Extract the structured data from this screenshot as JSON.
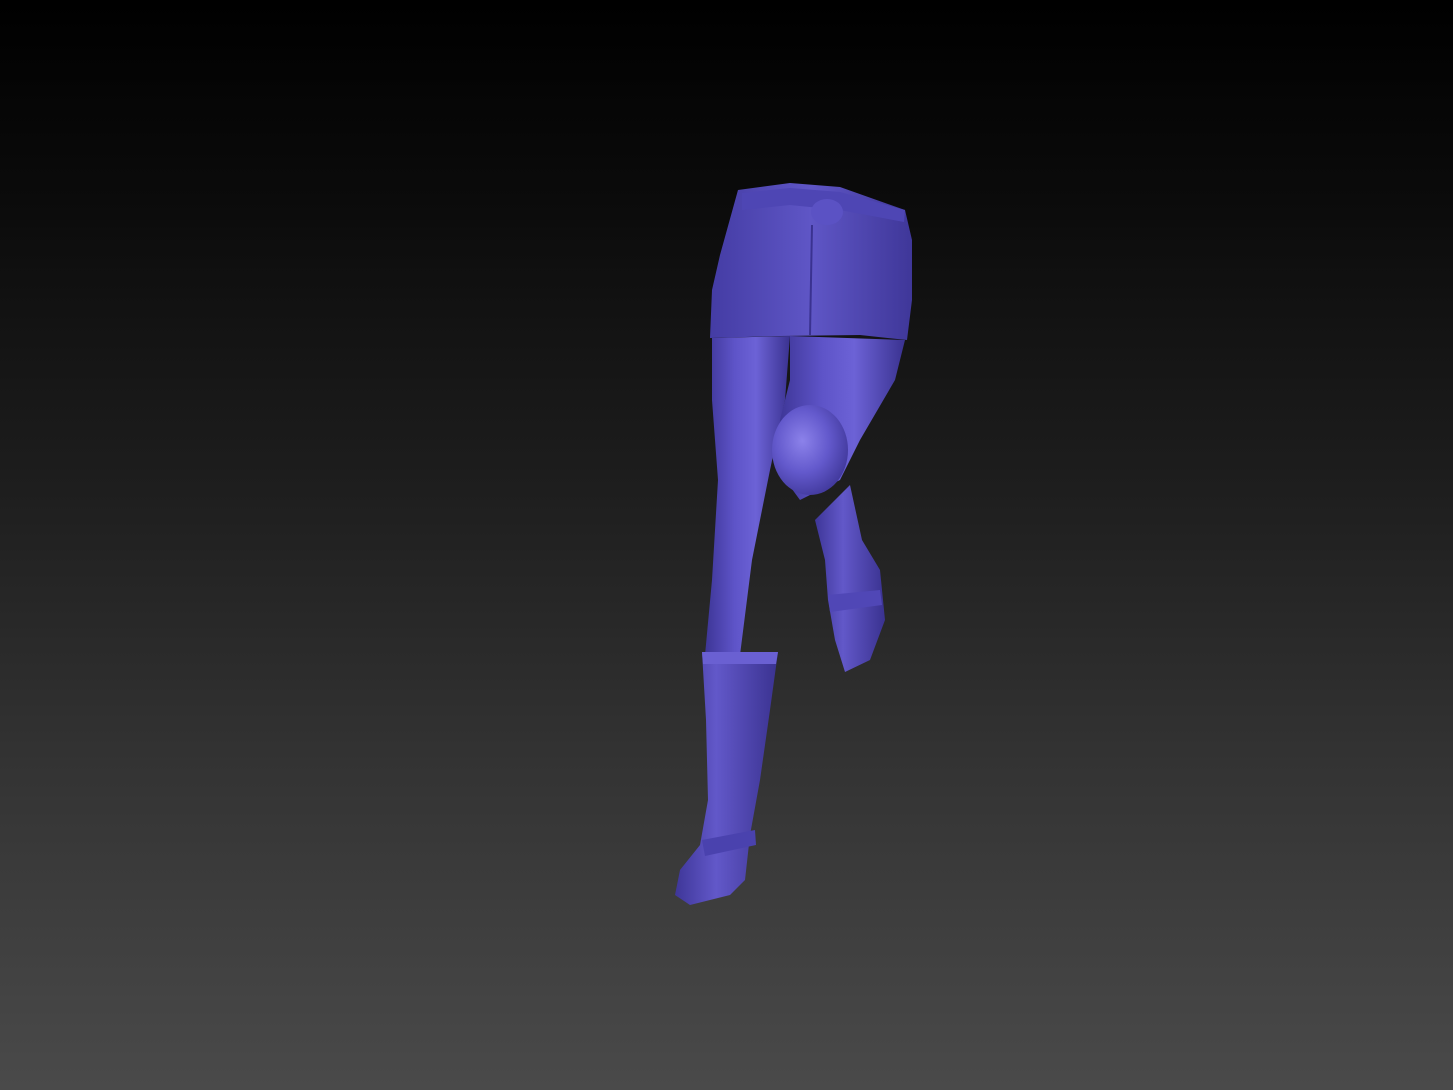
{
  "scene": {
    "background_top_color": "#000000",
    "background_bottom_color": "#4a4a4a",
    "model_color": "#5a4fc0",
    "model_highlight_color": "#8a80e8",
    "model_shadow_color": "#2a2370"
  }
}
